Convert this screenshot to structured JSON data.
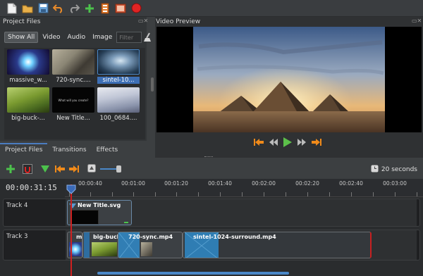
{
  "toolbar": {
    "buttons": [
      "new-file-icon",
      "open-folder-icon",
      "save-icon",
      "undo-icon",
      "redo-icon",
      "add-icon",
      "profile-icon",
      "fullscreen-icon",
      "record-icon"
    ]
  },
  "project_files": {
    "title": "Project Files",
    "filters": [
      "Show All",
      "Video",
      "Audio",
      "Image"
    ],
    "filter_placeholder": "Filter",
    "items": [
      {
        "label": "massive_w..."
      },
      {
        "label": "720-sync...."
      },
      {
        "label": "sintel-10..."
      },
      {
        "label": "big-buck-..."
      },
      {
        "label": "New Title..."
      },
      {
        "label": "100_0684...."
      }
    ],
    "thumb_text": "What will you create?"
  },
  "video_preview": {
    "title": "Video Preview"
  },
  "tabs": [
    "Project Files",
    "Transitions",
    "Effects"
  ],
  "timeline": {
    "zoom_label": "20 seconds",
    "time": "00:00:31:15",
    "ticks": [
      "00:00:40",
      "00:01:00",
      "00:01:20",
      "00:01:40",
      "00:02:00",
      "00:02:20",
      "00:02:40",
      "00:03:00"
    ],
    "tracks": [
      {
        "name": "Track 4",
        "clips": [
          {
            "title": "New Title.svg"
          }
        ]
      },
      {
        "name": "Track 3",
        "clips": [
          {
            "title": "m"
          },
          {
            "title": "big-buck-"
          },
          {
            "title": "720-sync.mp4"
          },
          {
            "title": "sintel-1024-surround.mp4"
          }
        ]
      }
    ]
  }
}
